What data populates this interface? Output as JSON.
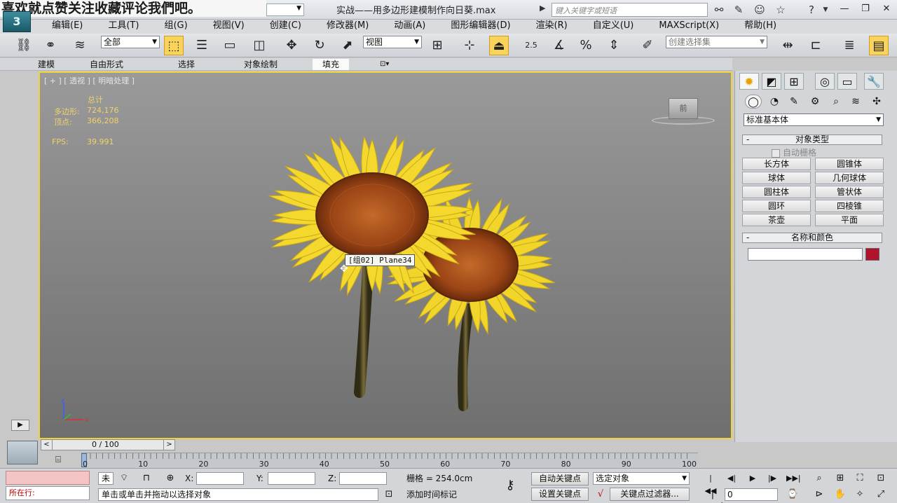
{
  "overlay_banner": "喜欢就点赞关注收藏评论我們吧。",
  "window": {
    "title": "实战——用多边形建模制作向日葵.max",
    "search_placeholder": "键入关键字或短语",
    "controls": [
      "—",
      "❐",
      "✕"
    ]
  },
  "menu": [
    "编辑(E)",
    "工具(T)",
    "组(G)",
    "视图(V)",
    "创建(C)",
    "修改器(M)",
    "动画(A)",
    "图形编辑器(D)",
    "渲染(R)",
    "自定义(U)",
    "MAXScript(X)",
    "帮助(H)"
  ],
  "toolbar": {
    "filter_value": "全部",
    "ref_coord_value": "视图",
    "snap_angle_label": "2.5",
    "percent_label": "%",
    "selection_set_placeholder": "创建选择集"
  },
  "ribbon_tabs": [
    "建模",
    "自由形式",
    "选择",
    "对象绘制",
    "填充"
  ],
  "viewport": {
    "label": "[ + ] [ 透视 ] [ 明暗处理 ]",
    "stats_title": "总计",
    "poly_label": "多边形:",
    "poly_value": "724,176",
    "vert_label": "顶点:",
    "vert_value": "366,208",
    "fps_label": "FPS:",
    "fps_value": "39.991",
    "tooltip": "[组02] Plane34",
    "viewcube_face": "前",
    "axis_z": "z",
    "axis_x": "x"
  },
  "command_panel": {
    "category_value": "标准基本体",
    "rollout_object_type": "对象类型",
    "autogrid_label": "自动栅格",
    "object_buttons": [
      "长方体",
      "圆锥体",
      "球体",
      "几何球体",
      "圆柱体",
      "管状体",
      "圆环",
      "四棱锥",
      "茶壶",
      "平面"
    ],
    "rollout_name_color": "名称和颜色",
    "swatch_color": "#b0132a"
  },
  "timeline": {
    "slider_label": "0 / 100",
    "ticks": [
      "0",
      "10",
      "20",
      "30",
      "40",
      "50",
      "60",
      "70",
      "80",
      "90",
      "100"
    ]
  },
  "status": {
    "listener_label": "所在行:",
    "prompt": "单击或单击并拖动以选择对象",
    "selection_none": "未",
    "x_label": "X:",
    "y_label": "Y:",
    "z_label": "Z:",
    "grid_label": "栅格 = 254.0cm",
    "add_time_tag": "添加时间标记",
    "auto_key": "自动关键点",
    "set_key": "设置关键点",
    "key_mode_value": "选定对象",
    "key_filters": "关键点过滤器...",
    "frame_value": "0"
  }
}
